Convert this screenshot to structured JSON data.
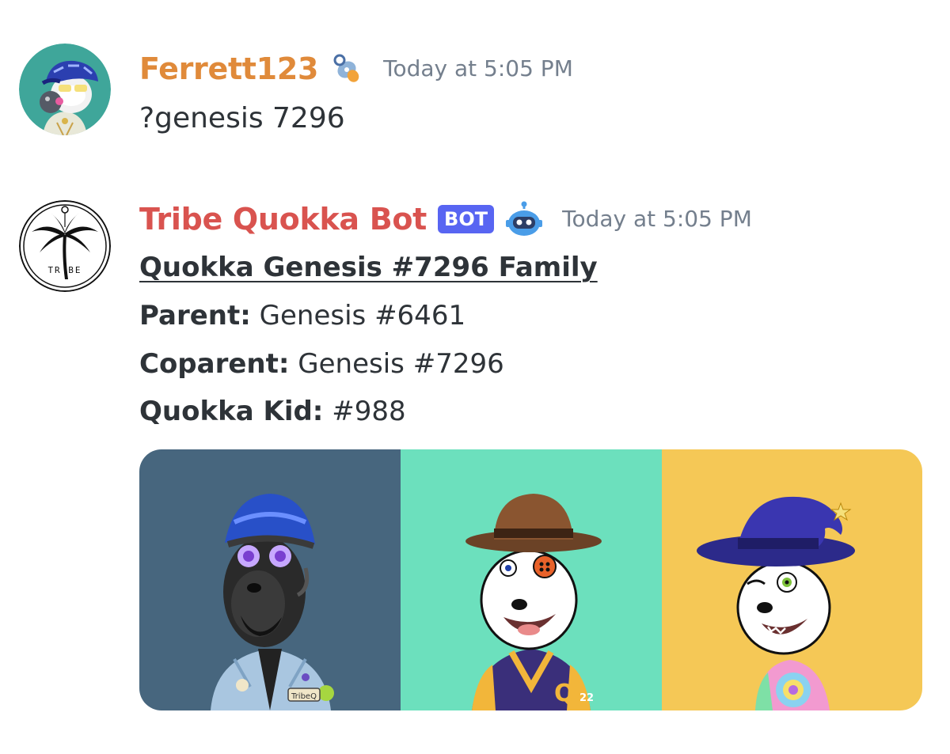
{
  "messages": [
    {
      "username": "Ferrett123",
      "username_color": "#e08a3a",
      "badge_icon": "pacifier-icon",
      "timestamp": "Today at 5:05 PM",
      "content": "?genesis 7296"
    },
    {
      "username": "Tribe Quokka Bot",
      "username_color": "#d9534f",
      "bot_tag": "BOT",
      "badge_icon": "robot-icon",
      "timestamp": "Today at 5:05 PM",
      "embed": {
        "title": "Quokka Genesis #7296 Family",
        "fields": [
          {
            "label": "Parent:",
            "value": " Genesis #6461"
          },
          {
            "label": "Coparent:",
            "value": " Genesis #7296"
          },
          {
            "label": "Quokka Kid:",
            "value": " #988"
          }
        ],
        "images": [
          {
            "name": "parent-quokka-image",
            "background": "#47667e"
          },
          {
            "name": "coparent-quokka-image",
            "background": "#6ce0bd"
          },
          {
            "name": "kid-quokka-image",
            "background": "#f5c856"
          }
        ]
      }
    }
  ],
  "avatar_text": {
    "tribe_logo": "TR BE"
  },
  "image_text": {
    "patch_label": "TribeQ",
    "jacket_letter": "Q",
    "jacket_number": "22"
  }
}
